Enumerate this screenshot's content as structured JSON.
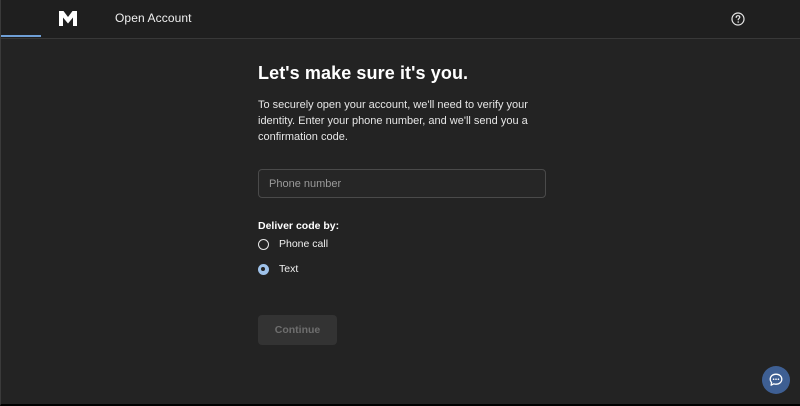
{
  "header": {
    "title": "Open Account",
    "logo_icon": "m1-logo-icon",
    "help_icon": "help-circle-icon"
  },
  "main": {
    "heading": "Let's make sure it's you.",
    "description": "To securely open your account, we'll need to verify your identity. Enter your phone number, and we'll send you a confirmation code.",
    "phone_input": {
      "value": "",
      "placeholder": "Phone number"
    },
    "deliver_label": "Deliver code by:",
    "options": [
      {
        "label": "Phone call",
        "checked": false
      },
      {
        "label": "Text",
        "checked": true
      }
    ],
    "continue_label": "Continue"
  },
  "chat": {
    "icon": "chat-bubble-icon"
  },
  "colors": {
    "accent": "#9fc2ea",
    "tab_indicator": "#6f9fd6",
    "chat_button": "#3e5f93",
    "background": "#232323"
  }
}
